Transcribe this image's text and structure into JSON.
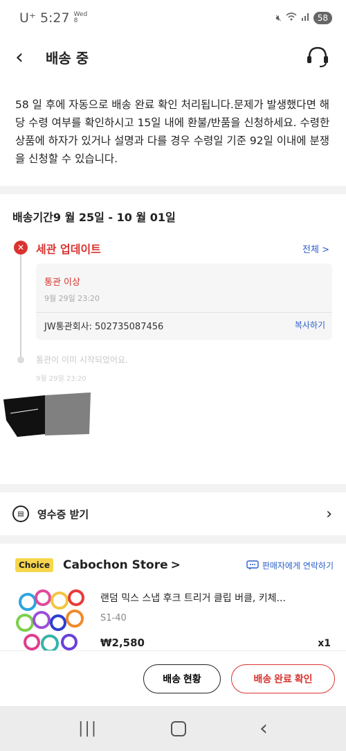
{
  "status_bar": {
    "carrier": "U⁺",
    "time": "5:27",
    "day": "Wed",
    "date": "8",
    "battery": "58"
  },
  "header": {
    "title": "배송 중"
  },
  "notice": {
    "text": "58 일 후에 자동으로 배송 완료 확인 처리됩니다.문제가 발생했다면 해당 수령 여부를 확인하시고 15일 내에 환불/반품을 신청하세요. 수령한 상품에 하자가 있거나 설명과 다를 경우 수령일 기준 92일 이내에 분쟁을 신청할 수 있습니다."
  },
  "delivery": {
    "period": "배송기간9 월 25일 - 10 월 01일",
    "latest_title": "세관 업데이트",
    "view_all": "전체 >",
    "event1": {
      "status": "통관 이상",
      "time": "9월 29일 23:20",
      "tracking": "JW통관회사: 502735087456",
      "copy_label": "복사하기"
    },
    "event2": {
      "status": "통관이 이미 시작되었어요.",
      "time": "9월 29일 23:20"
    }
  },
  "receipt": {
    "label": "영수증 받기"
  },
  "store": {
    "badge": "Choice",
    "name": "Cabochon Store",
    "arrow": ">",
    "contact_label": "판매자에게 연락하기"
  },
  "product": {
    "title": "랜덤 믹스 스냅 후크 트리거 클립 버클, 키체...",
    "sku": "S1-40",
    "price": "₩2,580",
    "qty": "x1"
  },
  "actions": {
    "status_button": "배송 현황",
    "confirm_button": "배송 완료 확인"
  },
  "colors": {
    "accent_red": "#d9322f",
    "link_blue": "#2a5fc9",
    "choice_yellow": "#f6d64a"
  }
}
